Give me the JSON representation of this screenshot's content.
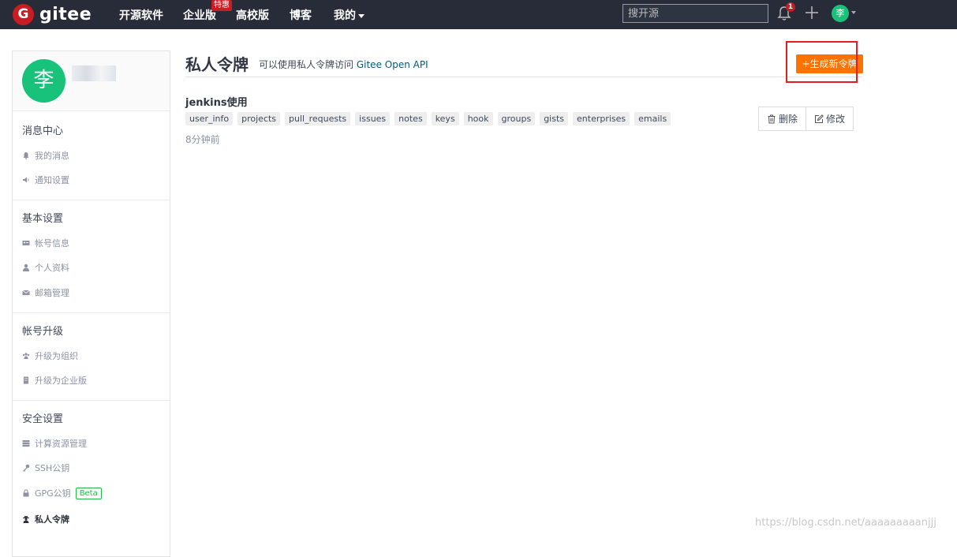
{
  "nav": {
    "logo_mark": "G",
    "logo_text": "gitee",
    "items": [
      "开源软件",
      "企业版",
      "高校版",
      "博客",
      "我的"
    ],
    "enterprise_tag": "特惠",
    "search_placeholder": "搜开源",
    "notification_count": "1",
    "avatar_initial": "李"
  },
  "sidebar": {
    "avatar_initial": "李",
    "sections": [
      {
        "title": "消息中心",
        "items": [
          "我的消息",
          "通知设置"
        ]
      },
      {
        "title": "基本设置",
        "items": [
          "帐号信息",
          "个人资料",
          "邮箱管理"
        ]
      },
      {
        "title": "帐号升级",
        "items": [
          "升级为组织",
          "升级为企业版"
        ]
      },
      {
        "title": "安全设置",
        "items": [
          "计算资源管理",
          "SSH公钥",
          "GPG公钥",
          "私人令牌"
        ]
      }
    ],
    "beta_label": "Beta"
  },
  "main": {
    "title": "私人令牌",
    "subtitle": "可以使用私人令牌访问",
    "api_link": "Gitee Open API",
    "new_token_button": "+生成新令牌",
    "token": {
      "name": "jenkins使用",
      "scopes": [
        "user_info",
        "projects",
        "pull_requests",
        "issues",
        "notes",
        "keys",
        "hook",
        "groups",
        "gists",
        "enterprises",
        "emails"
      ],
      "time": "8分钟前"
    },
    "delete_button": "删除",
    "edit_button": "修改"
  },
  "watermark": "https://blog.csdn.net/aaaaaaaaanjjj",
  "colors": {
    "nav_bg": "#272c38",
    "brand_red": "#c71d23",
    "accent_orange": "#fe7300",
    "avatar_green": "#19c27a",
    "highlight_red": "#e02020"
  }
}
